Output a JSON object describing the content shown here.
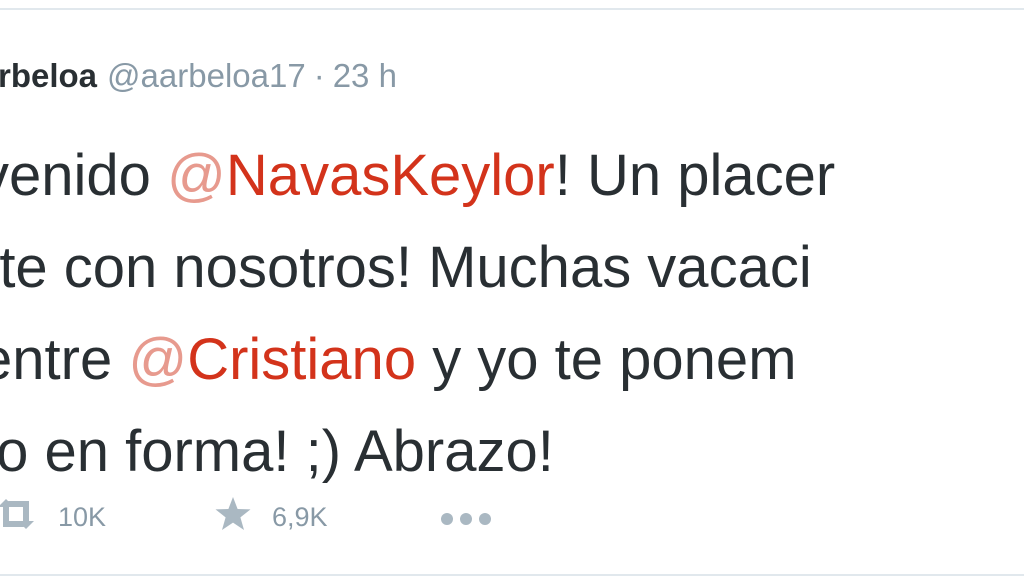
{
  "tweet": {
    "author_name": "rbeloa",
    "handle": "@aarbeloa17",
    "separator": "·",
    "time": "23 h",
    "lines": [
      {
        "before": "venido ",
        "mention_at": "@",
        "mention_name": "NavasKeylor",
        "after": "! Un placer"
      },
      {
        "text": "rte con nosotros! Muchas vacaci"
      },
      {
        "before": " entre ",
        "mention_at": "@",
        "mention_name": "Cristiano",
        "after": " y yo te ponem"
      },
      {
        "text": "to en forma! ;) Abrazo!"
      }
    ]
  },
  "actions": {
    "retweet_icon": "retweet-icon",
    "retweet_count": "10K",
    "favorite_icon": "star-icon",
    "favorite_count": "6,9K",
    "more_icon": "ellipsis-icon"
  },
  "colors": {
    "text": "#292f33",
    "mention": "#d3331b",
    "mention_at": "#e79a8e",
    "muted": "#8899a6",
    "icon": "#aab8c2",
    "border": "#e1e8ed"
  }
}
